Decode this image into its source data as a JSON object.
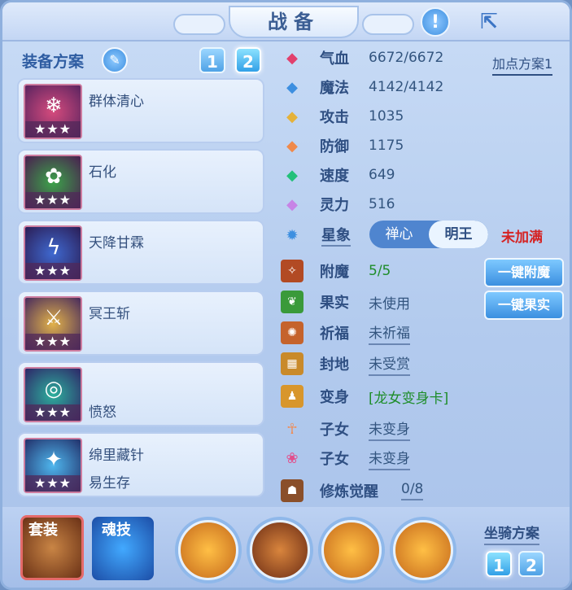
{
  "window": {
    "title": "战备"
  },
  "left": {
    "header": "装备方案",
    "plan_buttons": [
      "1",
      "2"
    ],
    "slots": [
      {
        "name": "群体清心",
        "name2": "",
        "stars": "★★★",
        "icon": "ice-icon"
      },
      {
        "name": "石化",
        "name2": "",
        "stars": "★★★",
        "icon": "vine-icon"
      },
      {
        "name": "天降甘霖",
        "name2": "",
        "stars": "★★★",
        "icon": "lightning-icon"
      },
      {
        "name": "冥王斩",
        "name2": "",
        "stars": "★★★",
        "icon": "chain-icon"
      },
      {
        "name": "",
        "name2": "愤怒",
        "stars": "★★★",
        "icon": "flame-ring-icon"
      },
      {
        "name": "绵里藏针",
        "name2": "易生存",
        "stars": "★★★",
        "icon": "needle-icon"
      }
    ]
  },
  "right": {
    "plan_link": "加点方案1",
    "stats": [
      {
        "label": "气血",
        "value": "6672/6672",
        "icon": "heart-gem-icon"
      },
      {
        "label": "魔法",
        "value": "4142/4142",
        "icon": "mana-gem-icon"
      },
      {
        "label": "攻击",
        "value": "1035",
        "icon": "sword-gem-icon"
      },
      {
        "label": "防御",
        "value": "1175",
        "icon": "shield-gem-icon"
      },
      {
        "label": "速度",
        "value": "649",
        "icon": "speed-gem-icon"
      },
      {
        "label": "灵力",
        "value": "516",
        "icon": "spirit-gem-icon"
      }
    ],
    "xingxiang": {
      "label": "星象",
      "options": [
        "禅心",
        "明王"
      ],
      "selected": "明王",
      "status": "未加满"
    },
    "extras": [
      {
        "label": "附魔",
        "value": "5/5",
        "green": true,
        "icon": "enchant-icon"
      },
      {
        "label": "果实",
        "value": "未使用",
        "icon": "fruit-icon"
      },
      {
        "label": "祈福",
        "value": "未祈福",
        "icon": "blessing-icon"
      },
      {
        "label": "封地",
        "value": "未受赏",
        "icon": "fief-icon"
      },
      {
        "label": "变身",
        "value": "[龙女变身卡]",
        "green": true,
        "icon": "transform-icon"
      },
      {
        "label": "子女",
        "value": "未变身",
        "icon": "child1-icon"
      },
      {
        "label": "子女",
        "value": "未变身",
        "icon": "child2-icon"
      },
      {
        "label": "修炼觉醒",
        "value": "0/8",
        "icon": "cultivation-icon"
      }
    ],
    "buttons": {
      "enchant": "一键附魔",
      "fruit": "一键果实"
    }
  },
  "bottom": {
    "suit": "套装",
    "soul": "魂技",
    "mount_plan": "坐骑方案",
    "mount_buttons": [
      "1",
      "2"
    ]
  },
  "colors": {
    "panel": "#b8ccef",
    "accent": "#3d8fe0",
    "red": "#d52222",
    "green": "#1e8d2a"
  }
}
